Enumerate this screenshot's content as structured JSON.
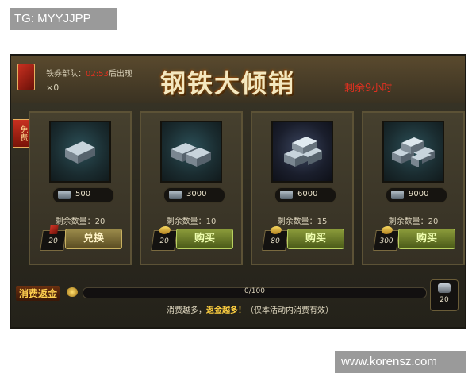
{
  "watermarks": {
    "top": "TG: MYYJJPP",
    "bottom": "www.korensz.com"
  },
  "header": {
    "coupon_label": "铁券部队：",
    "coupon_time": "02:53",
    "coupon_suffix": "后出现",
    "coupon_count": "×0",
    "title": "钢铁大倾销",
    "remaining": "剩余9小时"
  },
  "free_badge": "免费",
  "cards": [
    {
      "price": "500",
      "stock_label": "剩余数量：",
      "stock": "20",
      "cost": "20",
      "button": "兑换",
      "cost_icon": "red-coupon-icon",
      "button_color": "#9a8a4a"
    },
    {
      "price": "3000",
      "stock_label": "剩余数量：",
      "stock": "10",
      "cost": "20",
      "button": "购买",
      "cost_icon": "gold-ingot-icon",
      "button_color": "#8a9a3a"
    },
    {
      "price": "6000",
      "stock_label": "剩余数量：",
      "stock": "15",
      "cost": "80",
      "button": "购买",
      "cost_icon": "gold-ingot-icon",
      "button_color": "#8a9a3a"
    },
    {
      "price": "9000",
      "stock_label": "剩余数量：",
      "stock": "20",
      "cost": "300",
      "button": "购买",
      "cost_icon": "gold-ingot-icon",
      "button_color": "#8a9a3a"
    }
  ],
  "rebate": {
    "label": "消费返金",
    "progress_text": "0/100",
    "progress_fraction": 0,
    "reward_count": "20",
    "note_prefix": "消费越多，",
    "note_highlight": "返金越多！",
    "note_suffix": "（仅本活动内消费有效）"
  },
  "colors": {
    "accent_red": "#e03020",
    "gold": "#ffd050",
    "panel_bg": "#2b281e"
  }
}
